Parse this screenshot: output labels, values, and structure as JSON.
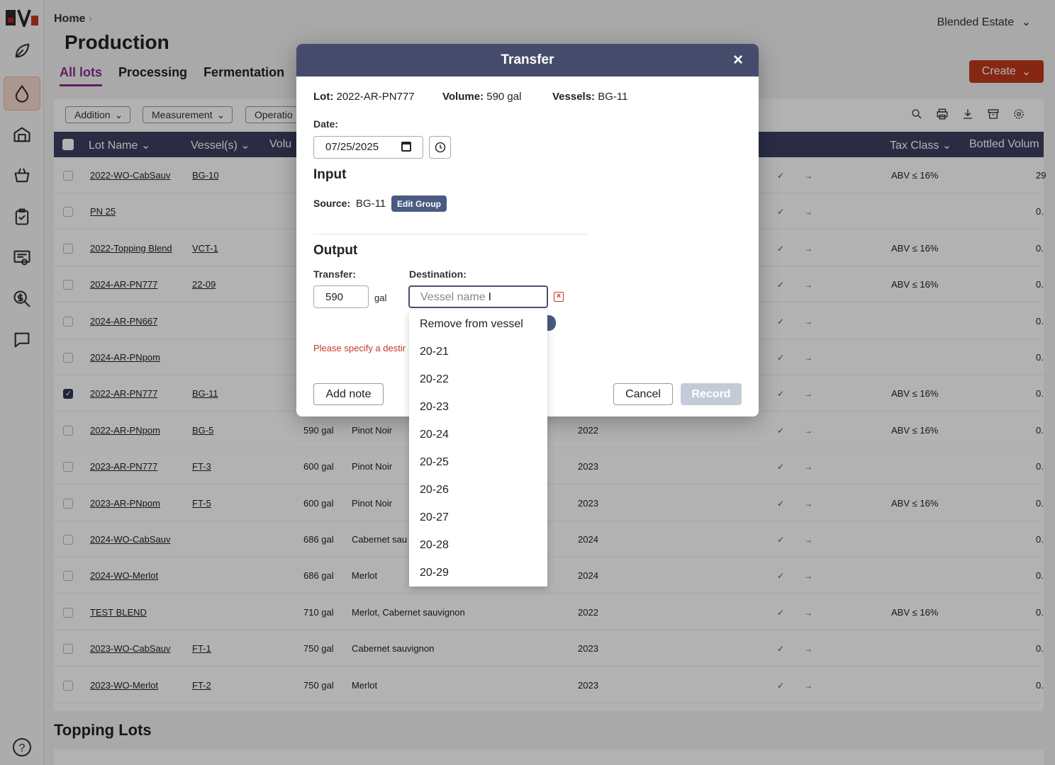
{
  "header": {
    "breadcrumb": "Home",
    "breadcrumb_sep": "›",
    "title": "Production",
    "estate": "Blended Estate",
    "create_label": "Create",
    "tabs": [
      "All lots",
      "Processing",
      "Fermentation"
    ]
  },
  "filters": [
    "Addition",
    "Measurement",
    "Operatio"
  ],
  "table": {
    "headers": {
      "lot_name": "Lot Name",
      "vessels": "Vessel(s)",
      "volume": "Volu",
      "tax_class": "Tax Class",
      "bottled": "Bottled Volum"
    },
    "rows": [
      {
        "lot": "2022-WO-CabSauv",
        "vessel": "BG-10",
        "volume": "",
        "varietal": "",
        "year": "",
        "tax": "ABV ≤ 16%",
        "bottled": "29",
        "checked": false
      },
      {
        "lot": "PN 25",
        "vessel": "",
        "volume": "",
        "varietal": "",
        "year": "",
        "tax": "",
        "bottled": "0.",
        "checked": false
      },
      {
        "lot": "2022-Topping Blend",
        "vessel": "VCT-1",
        "volume": "",
        "varietal": "",
        "year": "",
        "tax": "ABV ≤ 16%",
        "bottled": "0.",
        "checked": false
      },
      {
        "lot": "2024-AR-PN777",
        "vessel": "22-09",
        "volume": "",
        "varietal": "",
        "year": "",
        "tax": "ABV ≤ 16%",
        "bottled": "0.",
        "checked": false
      },
      {
        "lot": "2024-AR-PN667",
        "vessel": "",
        "volume": "",
        "varietal": "",
        "year": "",
        "tax": "",
        "bottled": "0.",
        "checked": false
      },
      {
        "lot": "2024-AR-PNpom",
        "vessel": "",
        "volume": "",
        "varietal": "",
        "year": "",
        "tax": "",
        "bottled": "0.",
        "checked": false
      },
      {
        "lot": "2022-AR-PN777",
        "vessel": "BG-11",
        "volume": "",
        "varietal": "",
        "year": "",
        "tax": "ABV ≤ 16%",
        "bottled": "0.",
        "checked": true
      },
      {
        "lot": "2022-AR-PNpom",
        "vessel": "BG-5",
        "volume": "590 gal",
        "varietal": "Pinot Noir",
        "year": "2022",
        "tax": "ABV ≤ 16%",
        "bottled": "0.",
        "checked": false
      },
      {
        "lot": "2023-AR-PN777",
        "vessel": "FT-3",
        "volume": "600 gal",
        "varietal": "Pinot Noir",
        "year": "2023",
        "tax": "",
        "bottled": "0.",
        "checked": false
      },
      {
        "lot": "2023-AR-PNpom",
        "vessel": "FT-5",
        "volume": "600 gal",
        "varietal": "Pinot Noir",
        "year": "2023",
        "tax": "ABV ≤ 16%",
        "bottled": "0.",
        "checked": false
      },
      {
        "lot": "2024-WO-CabSauv",
        "vessel": "",
        "volume": "686 gal",
        "varietal": "Cabernet sau",
        "year": "2024",
        "tax": "",
        "bottled": "0.",
        "checked": false
      },
      {
        "lot": "2024-WO-Merlot",
        "vessel": "",
        "volume": "686 gal",
        "varietal": "Merlot",
        "year": "2024",
        "tax": "",
        "bottled": "0.",
        "checked": false
      },
      {
        "lot": "TEST BLEND",
        "vessel": "",
        "volume": "710 gal",
        "varietal": "Merlot, Cabernet sauvignon",
        "year": "2022",
        "tax": "ABV ≤ 16%",
        "bottled": "0.",
        "checked": false
      },
      {
        "lot": "2023-WO-CabSauv",
        "vessel": "FT-1",
        "volume": "750 gal",
        "varietal": "Cabernet sauvignon",
        "year": "2023",
        "tax": "",
        "bottled": "0.",
        "checked": false
      },
      {
        "lot": "2023-WO-Merlot",
        "vessel": "FT-2",
        "volume": "750 gal",
        "varietal": "Merlot",
        "year": "2023",
        "tax": "",
        "bottled": "0.",
        "checked": false
      }
    ]
  },
  "topping": {
    "title": "Topping Lots"
  },
  "modal": {
    "title": "Transfer",
    "close": "×",
    "lot_label": "Lot:",
    "lot_value": "2022-AR-PN777",
    "volume_label": "Volume:",
    "volume_value": "590 gal",
    "vessels_label": "Vessels:",
    "vessels_value": "BG-11",
    "date_label": "Date:",
    "date_value": "07/25/2025",
    "input_title": "Input",
    "source_label": "Source:",
    "source_value": "BG-11",
    "edit_group": "Edit Group",
    "output_title": "Output",
    "transfer_label": "Transfer:",
    "transfer_value": "590",
    "transfer_unit": "gal",
    "destination_label": "Destination:",
    "destination_placeholder": "Vessel name",
    "error_text": "Please specify a destir",
    "add_note": "Add note",
    "cancel": "Cancel",
    "record": "Record"
  },
  "dropdown": {
    "items": [
      "Remove from vessel",
      "20-21",
      "20-22",
      "20-23",
      "20-24",
      "20-25",
      "20-26",
      "20-27",
      "20-28",
      "20-29"
    ]
  },
  "colors": {
    "accent": "#8a2f8a",
    "create": "#c0391e",
    "header_bar": "#3c4060",
    "modal_head": "#454c6b",
    "error": "#c0392b"
  }
}
